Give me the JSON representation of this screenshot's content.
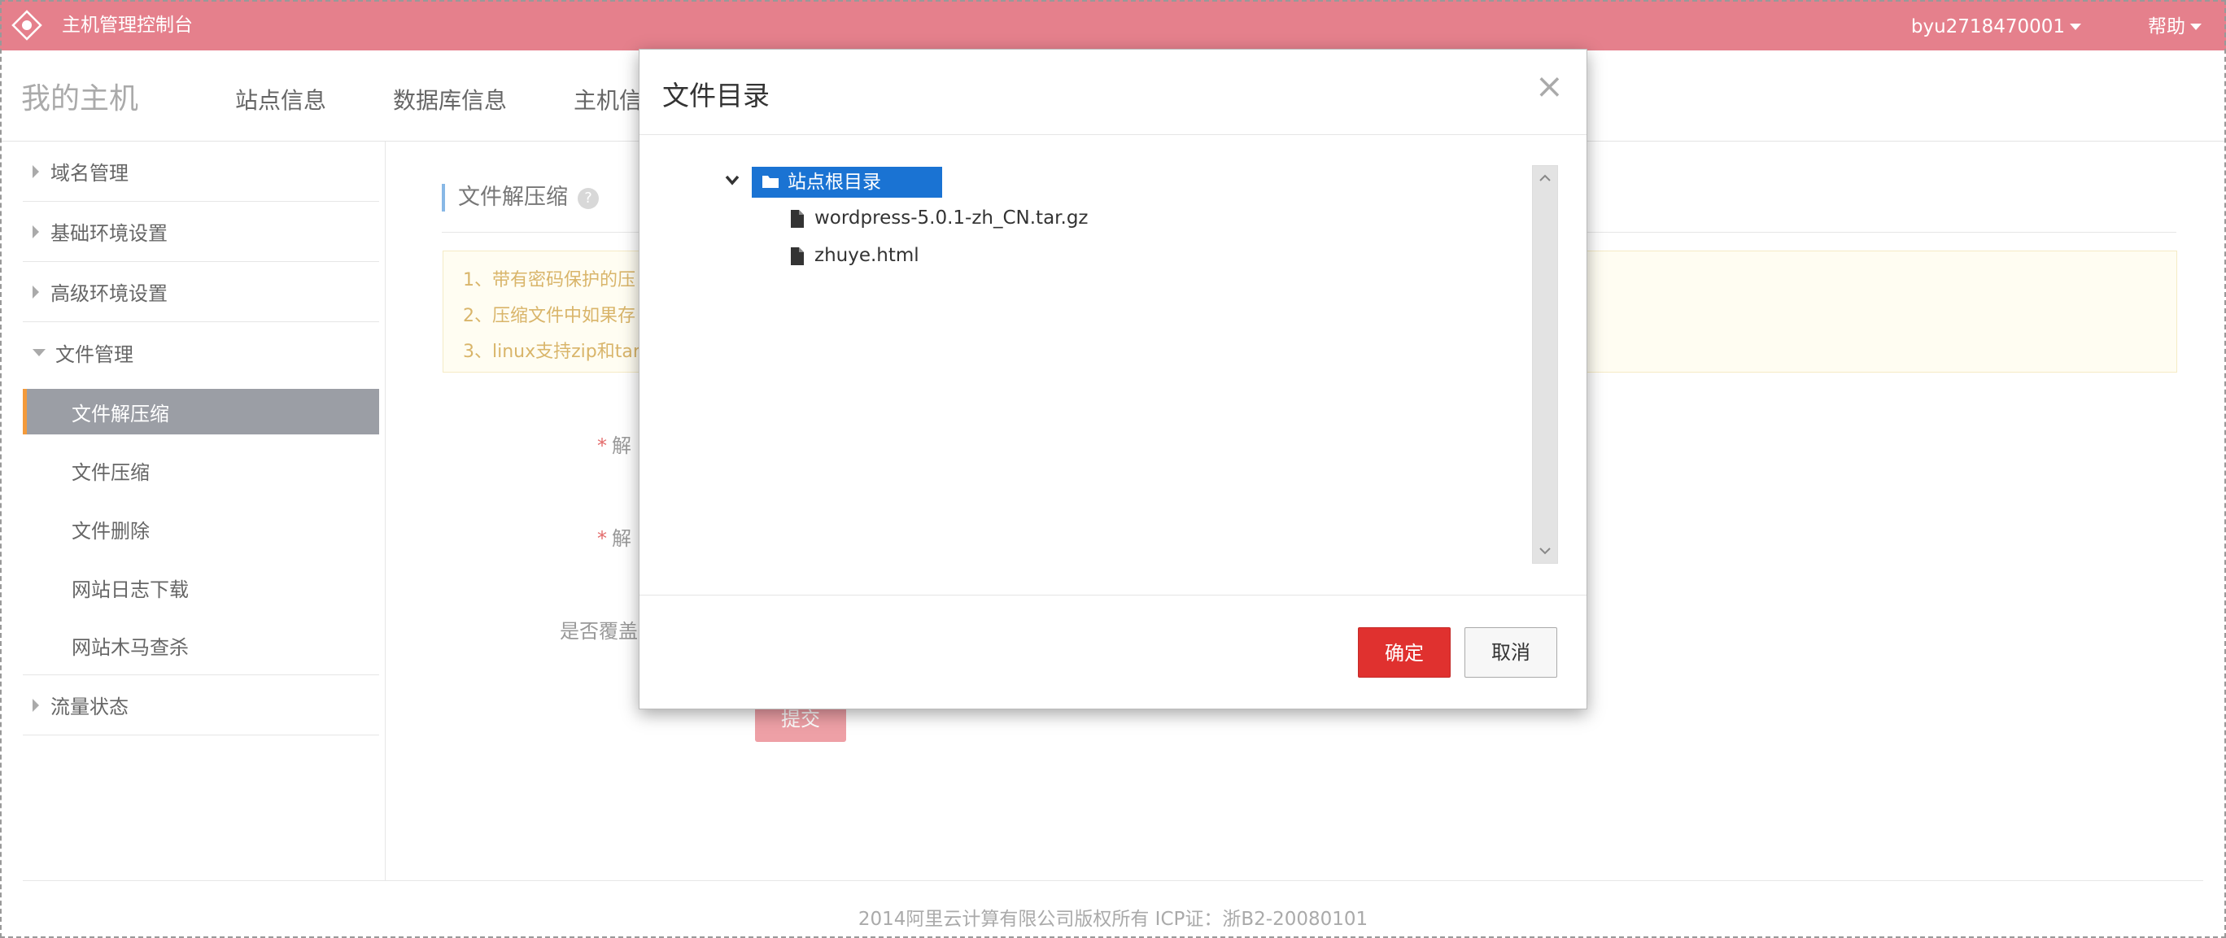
{
  "topbar": {
    "title": "主机管理控制台",
    "user": "byu2718470001",
    "help": "帮助"
  },
  "nav": {
    "brand": "我的主机",
    "tabs": [
      "站点信息",
      "数据库信息",
      "主机信"
    ]
  },
  "sidebar": {
    "domain": "域名管理",
    "basic_env": "基础环境设置",
    "advanced_env": "高级环境设置",
    "file_mgmt": "文件管理",
    "file_items": [
      "文件解压缩",
      "文件压缩",
      "文件删除",
      "网站日志下载",
      "网站木马查杀"
    ],
    "traffic": "流量状态"
  },
  "main": {
    "section_title": "文件解压缩",
    "help_icon": "?",
    "notices": [
      "1、带有密码保护的压",
      "2、压缩文件中如果存",
      "3、linux支持zip和tar"
    ],
    "required_mark": "*",
    "field1_label": "解",
    "field2_label": "解",
    "overwrite_label": "是否覆盖",
    "submit": "提交"
  },
  "modal": {
    "title": "文件目录",
    "close": "×",
    "root_folder": "站点根目录",
    "files": [
      "wordpress-5.0.1-zh_CN.tar.gz",
      "zhuye.html"
    ],
    "ok": "确定",
    "cancel": "取消"
  },
  "footer": {
    "copyright": "2014阿里云计算有限公司版权所有 ICP证：浙B2-20080101"
  },
  "colors": {
    "topbar": "#e5808c",
    "selection": "#1a73d3",
    "primary_button": "#e0312f",
    "active_sidebar": "#9b9ea5"
  }
}
